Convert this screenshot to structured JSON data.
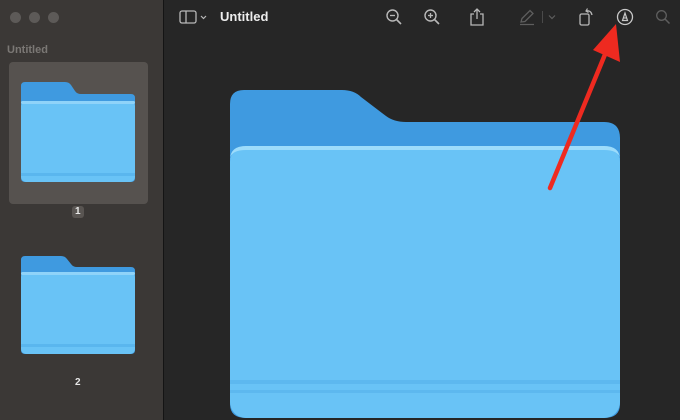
{
  "window": {
    "title": "Untitled"
  },
  "sidebar": {
    "title": "Untitled",
    "pages": [
      {
        "number": "1",
        "selected": true
      },
      {
        "number": "2",
        "selected": false
      }
    ]
  },
  "toolbar": {
    "sidebar_toggle_icon": "sidebar-icon",
    "zoom_out_icon": "zoom-out-icon",
    "zoom_in_icon": "zoom-in-icon",
    "share_icon": "share-icon",
    "highlight_icon": "pencil-icon",
    "rotate_icon": "rotate-icon",
    "markup_icon": "markup-icon",
    "search_icon": "search-icon"
  },
  "colors": {
    "folder_back": "#3f9ae0",
    "folder_front": "#69c3f6",
    "annotation_arrow": "#ee2a20"
  }
}
